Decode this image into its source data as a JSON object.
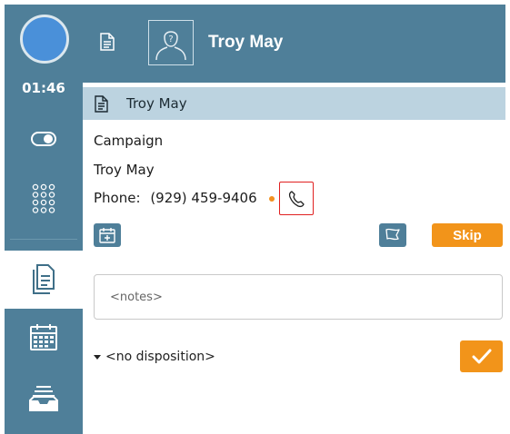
{
  "colors": {
    "rail": "#4f7f99",
    "panel_header": "#bcd3e0",
    "accent_orange": "#f2941a",
    "highlight_red": "#e02020",
    "avatar_blue": "#4a90d9"
  },
  "rail": {
    "status": "available",
    "timer": "01:46",
    "items": [
      {
        "name": "status-toggle",
        "icon": "toggle-icon"
      },
      {
        "name": "dialpad",
        "icon": "dialpad-icon"
      },
      {
        "name": "contact-record",
        "icon": "document-icon",
        "active": true
      },
      {
        "name": "calendar",
        "icon": "calendar-icon"
      },
      {
        "name": "inbox",
        "icon": "inbox-icon"
      }
    ]
  },
  "topbar": {
    "contact_name": "Troy May",
    "photo_icon": "unknown-person-icon"
  },
  "panel": {
    "header_title": "Troy May",
    "campaign": "Campaign",
    "contact_name": "Troy May",
    "phone_label": "Phone:",
    "phone_number": "(929) 459-9406",
    "skip_label": "Skip",
    "notes_placeholder": "<notes>",
    "disposition": "<no disposition>"
  }
}
